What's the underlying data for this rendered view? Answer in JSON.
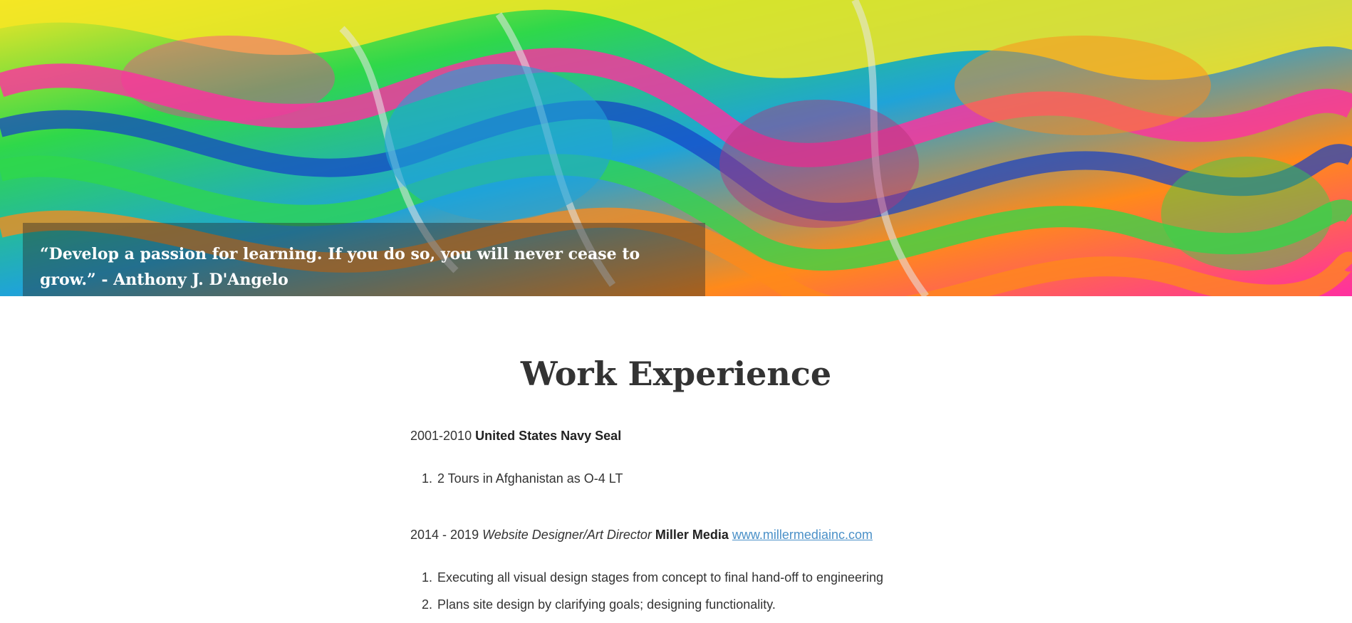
{
  "hero": {
    "quote": "“Develop a passion for learning. If you do so, you will never cease to grow.” - Anthony J. D'Angelo",
    "palette": [
      "#1fa3d8",
      "#f5e625",
      "#ff2fa0",
      "#2fd84a",
      "#ff8a1a",
      "#1440c8",
      "#e8e8e8",
      "#b8307a"
    ]
  },
  "main": {
    "title": "Work Experience",
    "jobs": [
      {
        "years": "2001-2010",
        "role": "",
        "company": "United States Navy Seal",
        "link": "",
        "duties": [
          "2 Tours in Afghanistan as O-4 LT"
        ]
      },
      {
        "years": "2014 - 2019",
        "role": "Website Designer/Art Director",
        "company": "Miller Media",
        "link": "www.millermediainc.com",
        "duties": [
          "Executing all visual design stages from concept to final hand-off to engineering",
          "Plans site design by clarifying goals; designing functionality."
        ]
      }
    ]
  }
}
